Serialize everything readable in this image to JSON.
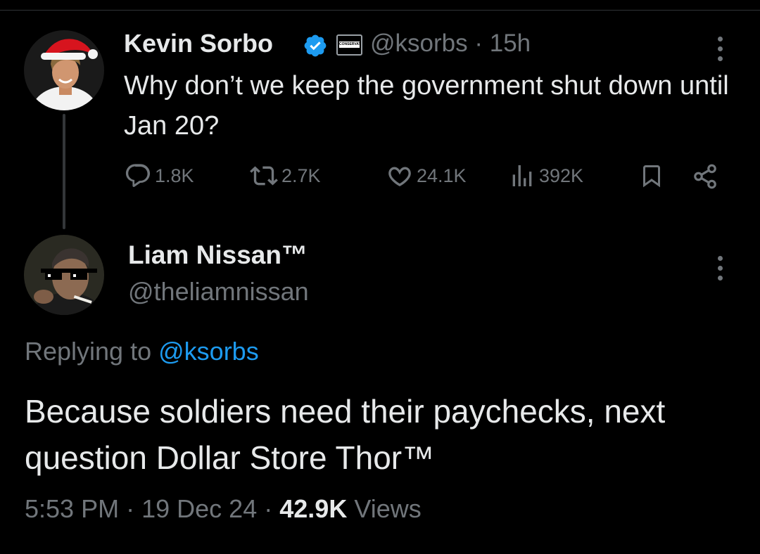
{
  "tweet": {
    "author_name": "Kevin Sorbo",
    "verified_icon": "verified-badge-icon",
    "affiliate_badge_text": "CONSERVATIVE",
    "handle": "@ksorbs",
    "separator": "·",
    "time": "15h",
    "text": "Why don’t we keep the government shut down until Jan 20?",
    "stats": {
      "replies": "1.8K",
      "reposts": "2.7K",
      "likes": "24.1K",
      "views": "392K"
    }
  },
  "reply": {
    "author_name": "Liam Nissan™",
    "handle": "@theliamnissan",
    "replying_prefix": "Replying to",
    "replying_mention": "@ksorbs",
    "text": "Because soldiers need their paychecks, next question Dollar Store Thor™",
    "time": "5:53 PM",
    "date": "19 Dec 24",
    "separator": "·",
    "views_count": "42.9K",
    "views_label": "Views"
  },
  "colors": {
    "background": "#000000",
    "text_primary": "#e7e9ea",
    "text_secondary": "#71767b",
    "accent": "#1d9bf0"
  }
}
